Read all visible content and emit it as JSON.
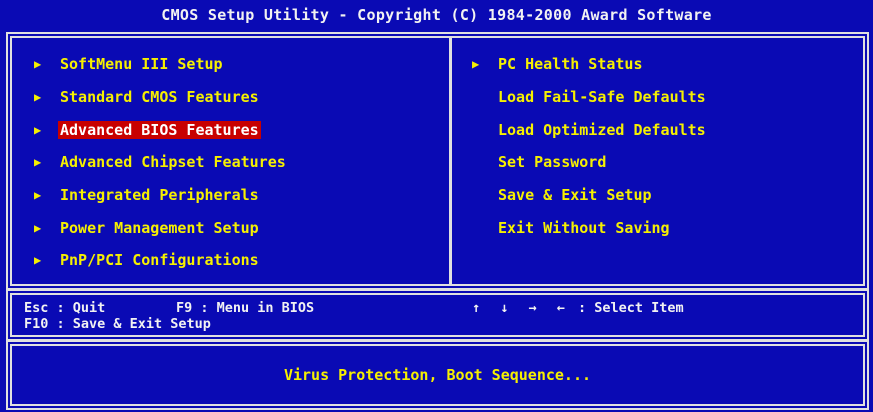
{
  "title": "CMOS Setup Utility - Copyright (C) 1984-2000 Award Software",
  "left_menu": [
    {
      "label": "SoftMenu III Setup",
      "has_arrow": true,
      "selected": false
    },
    {
      "label": "Standard CMOS Features",
      "has_arrow": true,
      "selected": false
    },
    {
      "label": "Advanced BIOS Features",
      "has_arrow": true,
      "selected": true
    },
    {
      "label": "Advanced Chipset Features",
      "has_arrow": true,
      "selected": false
    },
    {
      "label": "Integrated Peripherals",
      "has_arrow": true,
      "selected": false
    },
    {
      "label": "Power Management Setup",
      "has_arrow": true,
      "selected": false
    },
    {
      "label": "PnP/PCI Configurations",
      "has_arrow": true,
      "selected": false
    }
  ],
  "right_menu": [
    {
      "label": "PC Health Status",
      "has_arrow": true
    },
    {
      "label": "Load Fail-Safe Defaults",
      "has_arrow": false
    },
    {
      "label": "Load Optimized Defaults",
      "has_arrow": false
    },
    {
      "label": "Set Password",
      "has_arrow": false
    },
    {
      "label": "Save & Exit Setup",
      "has_arrow": false
    },
    {
      "label": "Exit Without Saving",
      "has_arrow": false
    }
  ],
  "keys": {
    "esc": "Esc : Quit",
    "f9": "F9 : Menu in BIOS",
    "arrows": "↑ ↓ → ←",
    "select": ": Select Item",
    "f10": "F10 : Save & Exit Setup"
  },
  "help_text": "Virus Protection, Boot Sequence...",
  "colors": {
    "background": "#0a0ab4",
    "menu_text": "#f6f000",
    "highlight": "#c80000",
    "frame": "#e0e0e0"
  }
}
